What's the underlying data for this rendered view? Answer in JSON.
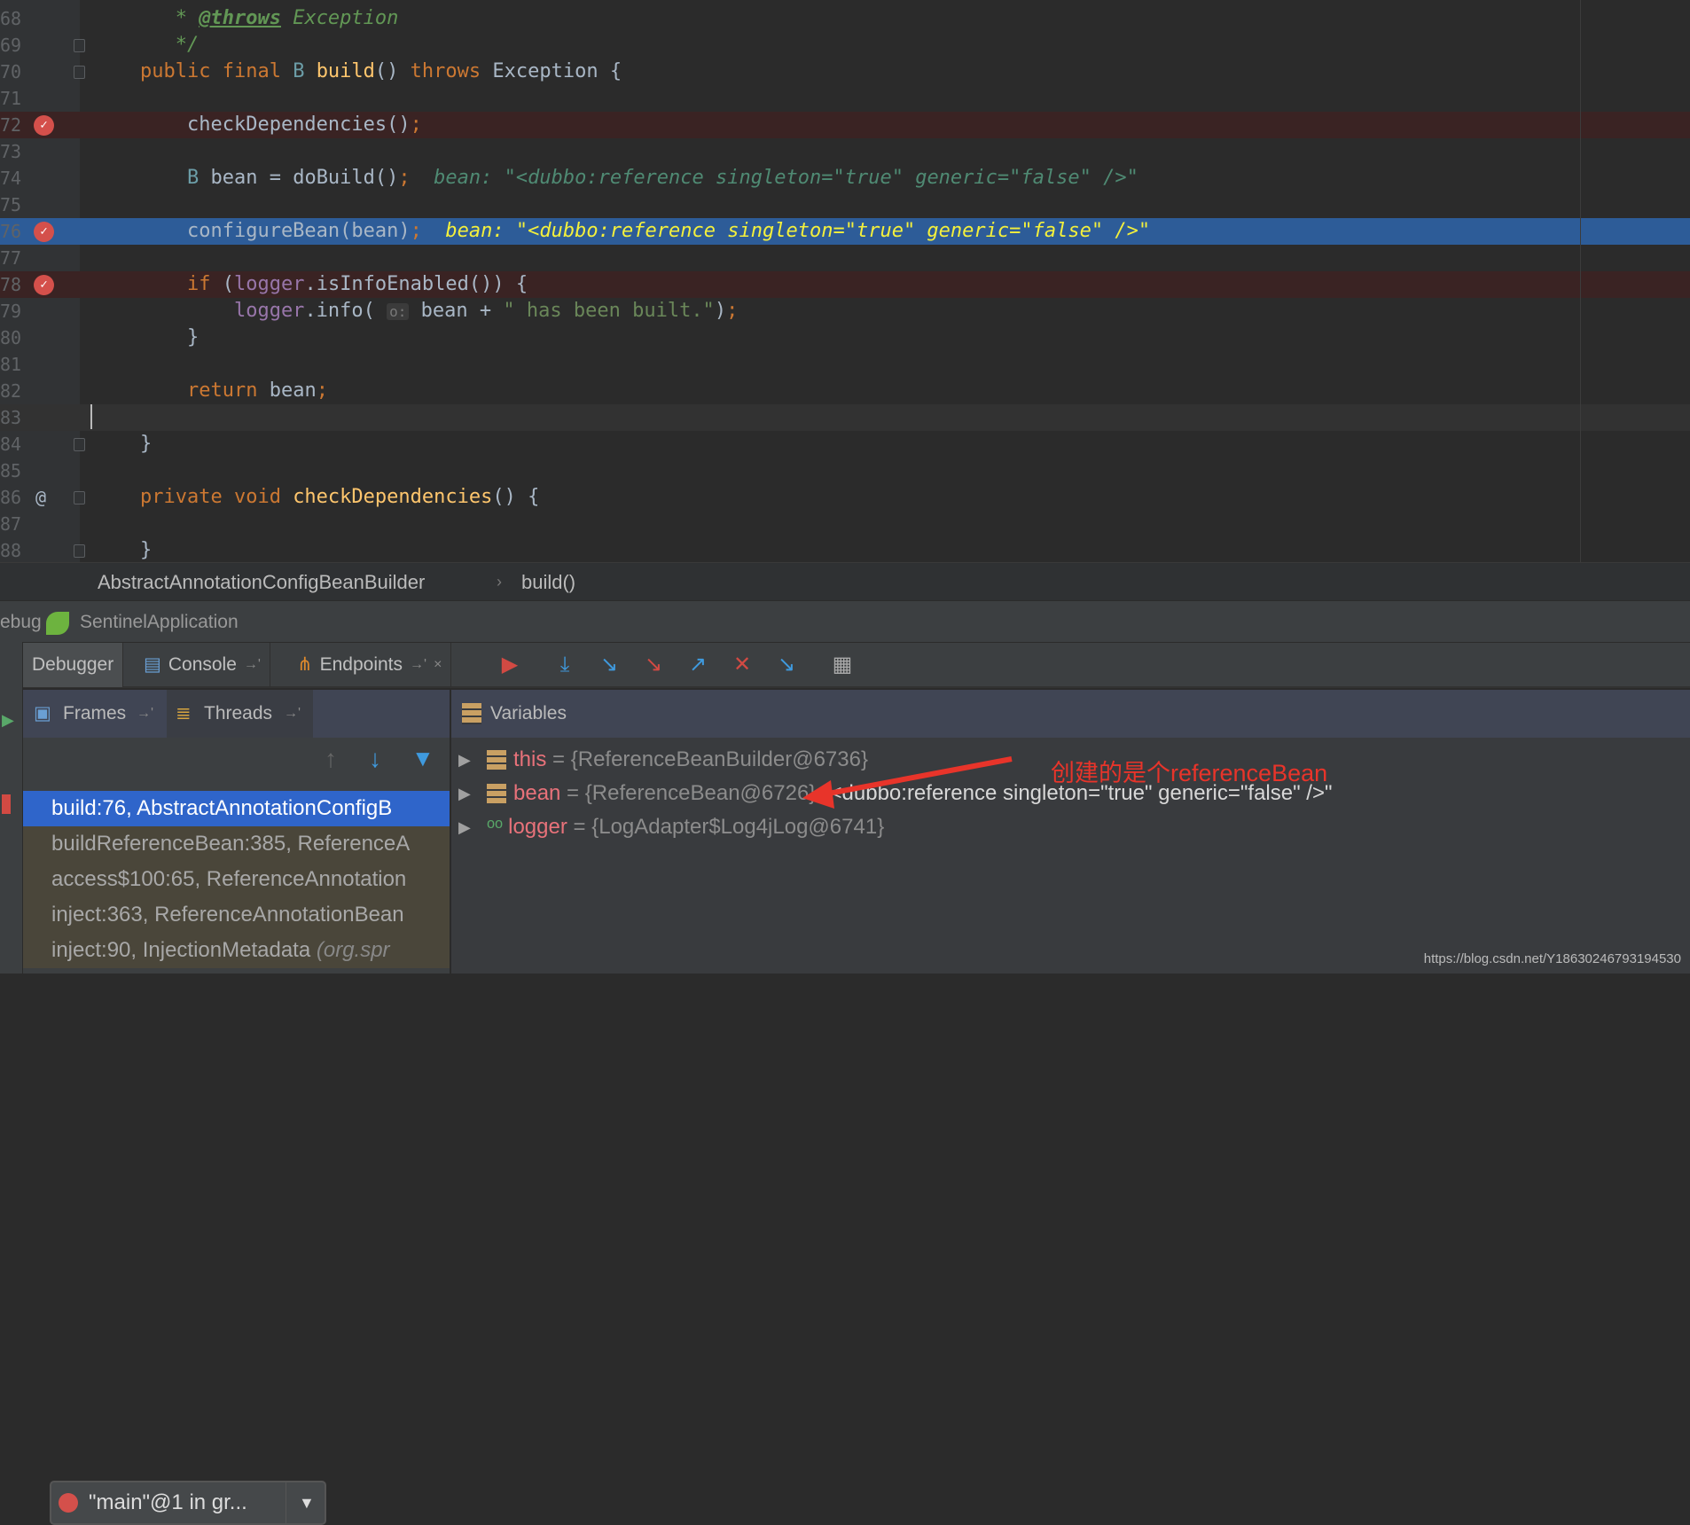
{
  "editor": {
    "lines": [
      {
        "num": "68",
        "tokens": [
          [
            "cm",
            "   * "
          ],
          [
            "cmt",
            "@throws"
          ],
          [
            "cm",
            " Exception"
          ]
        ]
      },
      {
        "num": "69",
        "fold": true,
        "tokens": [
          [
            "cm",
            "   */"
          ]
        ]
      },
      {
        "num": "70",
        "fold": true,
        "tokens": [
          [
            "kw",
            "public final "
          ],
          [
            "ty",
            "B "
          ],
          [
            "fn",
            "build"
          ],
          [
            "pl",
            "() "
          ],
          [
            "kw",
            "throws "
          ],
          [
            "pl",
            "Exception {"
          ]
        ]
      },
      {
        "num": "71",
        "tokens": []
      },
      {
        "num": "72",
        "breakpoint": true,
        "tokens": [
          [
            "pl",
            "    checkDependencies()"
          ],
          [
            "semi",
            ";"
          ]
        ]
      },
      {
        "num": "73",
        "tokens": []
      },
      {
        "num": "74",
        "tokens": [
          [
            "ty",
            "    B "
          ],
          [
            "pl",
            "bean = doBuild()"
          ],
          [
            "semi",
            ";"
          ],
          [
            "inl",
            "  bean: \"<dubbo:reference singleton=\"true\" generic=\"false\" />\""
          ]
        ]
      },
      {
        "num": "75",
        "tokens": []
      },
      {
        "num": "76",
        "breakpoint": true,
        "current": true,
        "tokens": [
          [
            "pl",
            "    configureBean(bean)"
          ],
          [
            "semi",
            ";"
          ],
          [
            "inlh",
            "  bean: \"<dubbo:reference singleton=\"true\" generic=\"false\" />\""
          ]
        ]
      },
      {
        "num": "77",
        "tokens": []
      },
      {
        "num": "78",
        "breakpoint": true,
        "tokens": [
          [
            "kw",
            "    if "
          ],
          [
            "pl",
            "("
          ],
          [
            "pu",
            "logger"
          ],
          [
            "pl",
            ".isInfoEnabled()) {"
          ]
        ]
      },
      {
        "num": "79",
        "tokens": [
          [
            "pu",
            "        logger"
          ],
          [
            "pl",
            ".info( "
          ],
          [
            "hint",
            "o:"
          ],
          [
            "pl",
            " bean + "
          ],
          [
            "st",
            "\" has been built.\""
          ],
          [
            "pl",
            ")"
          ],
          [
            "semi",
            ";"
          ]
        ]
      },
      {
        "num": "80",
        "tokens": [
          [
            "pl",
            "    }"
          ]
        ]
      },
      {
        "num": "81",
        "tokens": []
      },
      {
        "num": "82",
        "tokens": [
          [
            "kw",
            "    return "
          ],
          [
            "pl",
            "bean"
          ],
          [
            "semi",
            ";"
          ]
        ]
      },
      {
        "num": "83",
        "caret": true,
        "tokens": []
      },
      {
        "num": "84",
        "fold": true,
        "tokens": [
          [
            "pl",
            "}"
          ]
        ]
      },
      {
        "num": "85",
        "tokens": []
      },
      {
        "num": "86",
        "override": true,
        "fold": true,
        "tokens": [
          [
            "kw",
            "private void "
          ],
          [
            "fn",
            "checkDependencies"
          ],
          [
            "pl",
            "() {"
          ]
        ]
      },
      {
        "num": "87",
        "tokens": []
      },
      {
        "num": "88",
        "fold": true,
        "tokens": [
          [
            "pl",
            "}"
          ]
        ]
      }
    ]
  },
  "breadcrumb": {
    "class_name": "AbstractAnnotationConfigBeanBuilder",
    "separator": "›",
    "method": "build()"
  },
  "debug_header": {
    "label": "ebug",
    "config": "SentinelApplication"
  },
  "toolbar": {
    "tabs": [
      {
        "label": "Debugger"
      },
      {
        "label": "Console"
      },
      {
        "label": "Endpoints"
      }
    ],
    "pin": "→'",
    "close": "×"
  },
  "frames": {
    "tab_frames": "Frames",
    "tab_threads": "Threads",
    "pin": "→'",
    "thread_selector": "\"main\"@1 in gr...",
    "items": [
      {
        "label": "build:76, AbstractAnnotationConfigB",
        "active": true
      },
      {
        "label": "buildReferenceBean:385, ReferenceA"
      },
      {
        "label": "access$100:65, ReferenceAnnotation"
      },
      {
        "label": "inject:363, ReferenceAnnotationBean"
      },
      {
        "label": "inject:90, InjectionMetadata ",
        "pkg": "(org.spr"
      }
    ]
  },
  "variables": {
    "title": "Variables",
    "items": [
      {
        "name": "this",
        "eq": " = ",
        "value": "{ReferenceBeanBuilder@6736}",
        "extra": ""
      },
      {
        "name": "bean",
        "eq": " = ",
        "value": "{ReferenceBean@6726}",
        "extra": " \"<dubbo:reference singleton=\"true\" generic=\"false\" />\""
      },
      {
        "name": "logger",
        "eq": " = ",
        "value": "{LogAdapter$Log4jLog@6741}",
        "extra": ""
      }
    ]
  },
  "annotation": {
    "text": "创建的是个referenceBean",
    "color": "#e8342a"
  },
  "watermark": "https://blog.csdn.net/Y18630246793194530"
}
